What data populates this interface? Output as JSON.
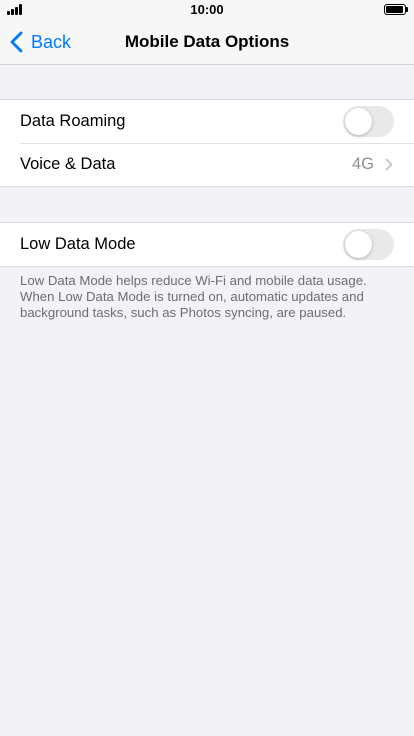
{
  "status_bar": {
    "time": "10:00",
    "signal_icon": "cellular-signal-icon",
    "battery_icon": "battery-icon"
  },
  "nav": {
    "back_label": "Back",
    "title": "Mobile Data Options",
    "accent": "#007aff"
  },
  "groups": [
    {
      "rows": [
        {
          "label": "Data Roaming",
          "control": "toggle",
          "on": false
        },
        {
          "label": "Voice & Data",
          "value": "4G",
          "control": "disclosure"
        }
      ]
    },
    {
      "rows": [
        {
          "label": "Low Data Mode",
          "control": "toggle",
          "on": false
        }
      ],
      "footer": "Low Data Mode helps reduce Wi-Fi and mobile data usage. When Low Data Mode is turned on, automatic updates and background tasks, such as Photos syncing, are paused."
    }
  ]
}
